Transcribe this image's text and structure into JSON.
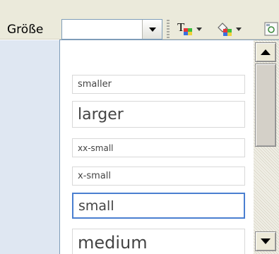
{
  "toolbar": {
    "size_label": "Größe",
    "size_value": "",
    "icons": [
      "text-color-icon",
      "background-color-icon",
      "more-icon"
    ]
  },
  "dropdown": {
    "items": [
      {
        "label": "smaller"
      },
      {
        "label": "larger"
      },
      {
        "label": "xx-small"
      },
      {
        "label": "x-small"
      },
      {
        "label": "small",
        "selected": true
      },
      {
        "label": "medium"
      }
    ]
  },
  "colors": {
    "toolbar_bg": "#ebeadb",
    "selection_border": "#4a7fd0",
    "editor_bg": "#dfe7f2"
  }
}
